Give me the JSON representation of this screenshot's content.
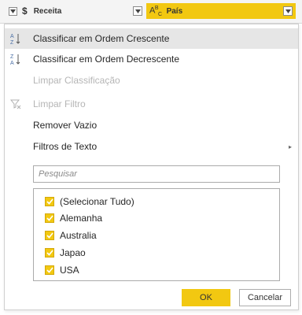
{
  "header": {
    "receita": {
      "type_icon": "$",
      "label": "Receita"
    },
    "pais": {
      "type_icon_main": "A",
      "type_icon_sup": "B",
      "type_icon_sub": "C",
      "label": "País"
    }
  },
  "menu": {
    "items": [
      {
        "label": "Classificar em Ordem Crescente",
        "icon": "sort-ascending-icon",
        "state": "hover"
      },
      {
        "label": "Classificar em Ordem Decrescente",
        "icon": "sort-descending-icon",
        "state": "normal"
      },
      {
        "label": "Limpar Classificação",
        "icon": "",
        "state": "disabled"
      },
      {
        "label": "Limpar Filtro",
        "icon": "clear-filter-icon",
        "state": "disabled"
      },
      {
        "label": "Remover Vazio",
        "icon": "",
        "state": "normal"
      },
      {
        "label": "Filtros de Texto",
        "icon": "",
        "state": "normal",
        "submenu_arrow": "▸"
      }
    ],
    "search": {
      "placeholder": "Pesquisar",
      "value": ""
    },
    "values": [
      {
        "label": "(Selecionar Tudo)",
        "checked": true
      },
      {
        "label": "Alemanha",
        "checked": true
      },
      {
        "label": "Australia",
        "checked": true
      },
      {
        "label": "Japao",
        "checked": true
      },
      {
        "label": "USA",
        "checked": true
      }
    ],
    "ok_label": "OK",
    "cancel_label": "Cancelar"
  },
  "colors": {
    "accent": "#f2c811",
    "hover": "#e6e6e6",
    "disabled_text": "#b5b5b5"
  }
}
